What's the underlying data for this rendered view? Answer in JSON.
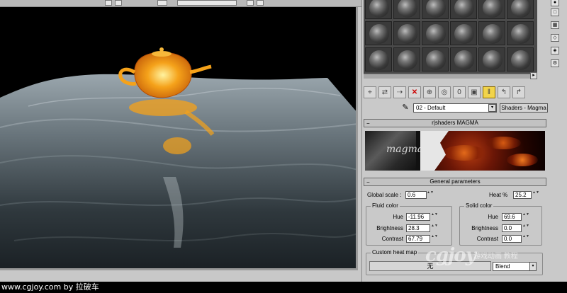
{
  "material_editor": {
    "material_name": "02 - Default",
    "material_type": "Shaders - Magma",
    "shader_rollout_title": "r|shaders MAGMA",
    "banner_logo": "magma",
    "general_rollout_title": "General parameters",
    "global_scale_label": "Global scale :",
    "global_scale_value": "0.6",
    "heat_label": "Heat %",
    "heat_value": "25.2",
    "fluid_color": {
      "title": "Fluid color",
      "hue_label": "Hue",
      "hue_value": "-11.96",
      "brightness_label": "Brightness",
      "brightness_value": "28.3",
      "contrast_label": "Contrast",
      "contrast_value": "67.79"
    },
    "solid_color": {
      "title": "Solid color",
      "hue_label": "Hue",
      "hue_value": "69.6",
      "brightness_label": "Brightness",
      "brightness_value": "0.0",
      "contrast_label": "Contrast",
      "contrast_value": "0.0"
    },
    "heat_map_title": "Custom heat map",
    "heat_map_button": "无",
    "blend_value": "Blend"
  },
  "watermark": {
    "logo": "cgjoy",
    "sub": "游戏动画 教程"
  },
  "credit": "www.cgjoy.com by 拉破车",
  "icons": {
    "minus": "−",
    "dropdown": "▾",
    "spin": "▲▼"
  },
  "colors": {
    "lava": "#f5a21a",
    "water": "#6b7a82",
    "active_tool": "#f2d44a"
  }
}
